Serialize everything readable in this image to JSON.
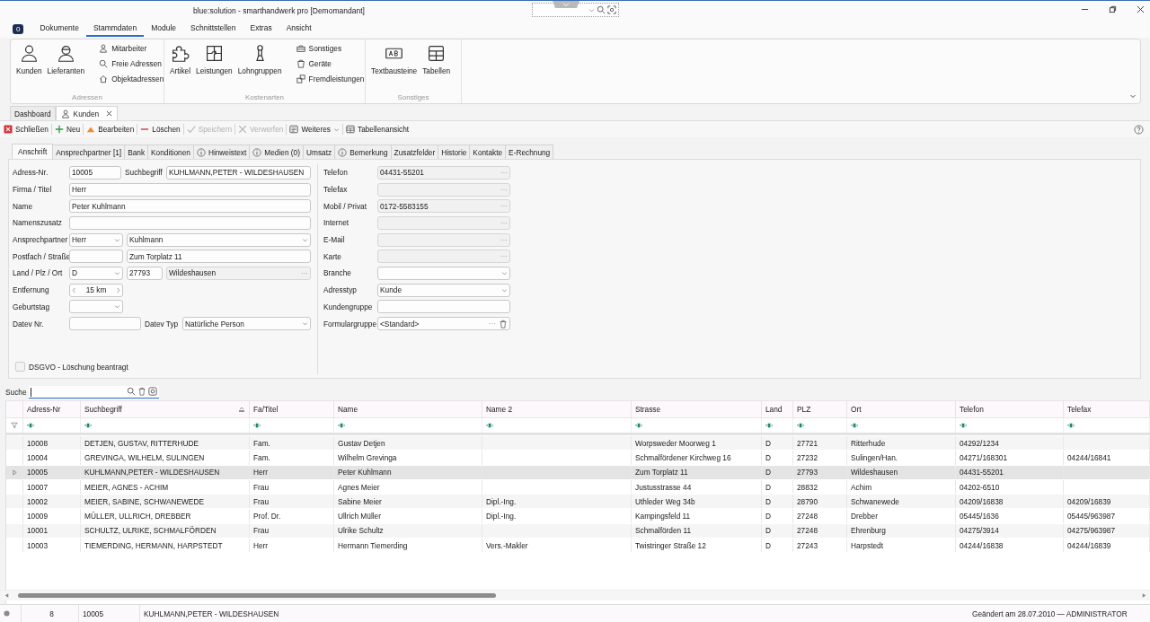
{
  "window": {
    "title": "blue:solution - smarthandwerk pro [Demomandant]"
  },
  "menu": {
    "badge": "0",
    "tabs": [
      {
        "label": "Dokumente",
        "selected": false
      },
      {
        "label": "Stammdaten",
        "selected": true
      },
      {
        "label": "Module",
        "selected": false
      },
      {
        "label": "Schnittstellen",
        "selected": false
      },
      {
        "label": "Extras",
        "selected": false
      },
      {
        "label": "Ansicht",
        "selected": false
      }
    ]
  },
  "ribbon": {
    "groups": [
      {
        "label": "Adressen",
        "large": [
          "Kunden",
          "Lieferanten"
        ],
        "small": [
          "Mitarbeiter",
          "Freie Adressen",
          "Objektadressen"
        ]
      },
      {
        "label": "Kostenarten",
        "large": [
          "Artikel",
          "Leistungen",
          "Lohngruppen"
        ],
        "small": [
          "Sonstiges",
          "Geräte",
          "Fremdleistungen"
        ]
      },
      {
        "label": "Sonstiges",
        "large": [
          "Textbausteine",
          "Tabellen"
        ]
      }
    ]
  },
  "document_tabs": [
    {
      "label": "Dashboard",
      "selected": false,
      "closable": false
    },
    {
      "label": "Kunden",
      "selected": true,
      "closable": true
    }
  ],
  "toolbar": [
    {
      "kind": "close",
      "label": "Schließen",
      "disabled": false
    },
    {
      "kind": "add",
      "label": "Neu",
      "disabled": false
    },
    {
      "kind": "edit",
      "label": "Bearbeiten",
      "disabled": false
    },
    {
      "kind": "delete",
      "label": "Löschen",
      "disabled": false
    },
    {
      "kind": "save",
      "label": "Speichern",
      "disabled": true
    },
    {
      "kind": "discard",
      "label": "Verwerfen",
      "disabled": true
    },
    {
      "kind": "menu",
      "label": "Weiteres",
      "disabled": false
    },
    {
      "kind": "table",
      "label": "Tabellenansicht",
      "disabled": false
    }
  ],
  "form_tabs": [
    {
      "label": "Anschrift",
      "selected": true,
      "info": false
    },
    {
      "label": "Ansprechpartner [1]",
      "selected": false,
      "info": false
    },
    {
      "label": "Bank",
      "selected": false,
      "info": false
    },
    {
      "label": "Konditionen",
      "selected": false,
      "info": false
    },
    {
      "label": "Hinweistext",
      "selected": false,
      "info": true
    },
    {
      "label": "Medien (0)",
      "selected": false,
      "info": true
    },
    {
      "label": "Umsatz",
      "selected": false,
      "info": false
    },
    {
      "label": "Bemerkung",
      "selected": false,
      "info": true
    },
    {
      "label": "Zusatzfelder",
      "selected": false,
      "info": false
    },
    {
      "label": "Historie",
      "selected": false,
      "info": false
    },
    {
      "label": "Kontakte",
      "selected": false,
      "info": false
    },
    {
      "label": "E-Rechnung",
      "selected": false,
      "info": false
    }
  ],
  "form_left": [
    {
      "label": "Adress-Nr.",
      "fields": [
        {
          "kind": "text",
          "value": "10005"
        },
        {
          "kind": "label",
          "value": "Suchbegriff"
        },
        {
          "kind": "text",
          "value": "KUHLMANN,PETER - WILDESHAUSEN"
        }
      ]
    },
    {
      "label": "Firma / Titel",
      "fields": [
        {
          "kind": "text",
          "value": "Herr"
        }
      ]
    },
    {
      "label": "Name",
      "fields": [
        {
          "kind": "text",
          "value": "Peter Kuhlmann"
        }
      ]
    },
    {
      "label": "Namenszusatz",
      "fields": [
        {
          "kind": "text"
        }
      ]
    },
    {
      "label": "Ansprechpartner",
      "fields": [
        {
          "kind": "select",
          "value": "Herr"
        },
        {
          "kind": "select",
          "value": "Kuhlmann"
        }
      ]
    },
    {
      "label": "Postfach / Straße",
      "fields": [
        {
          "kind": "text"
        },
        {
          "kind": "text",
          "value": "Zum Torplatz 11"
        }
      ]
    },
    {
      "label": "Land / Plz / Ort",
      "fields": [
        {
          "kind": "select",
          "value": "D"
        },
        {
          "kind": "text",
          "value": "27793"
        },
        {
          "kind": "lookup",
          "value": "Wildeshausen"
        }
      ]
    },
    {
      "label": "Entfernung",
      "fields": [
        {
          "kind": "spin",
          "value": "15 km"
        }
      ]
    },
    {
      "label": "Geburtstag",
      "fields": [
        {
          "kind": "select"
        }
      ]
    },
    {
      "label": "Datev Nr.",
      "fields": [
        {
          "kind": "text"
        },
        {
          "kind": "label",
          "value": "Datev Typ"
        },
        {
          "kind": "select",
          "value": "Natürliche Person"
        }
      ]
    }
  ],
  "gdpr_checkbox": {
    "label": "DSGVO - Löschung beantragt",
    "checked": false
  },
  "form_right": [
    {
      "label": "Telefon",
      "field": {
        "kind": "lookup",
        "value": "04431-55201"
      }
    },
    {
      "label": "Telefax",
      "field": {
        "kind": "lookup"
      }
    },
    {
      "label": "Mobil / Privat",
      "field": {
        "kind": "lookup",
        "value": "0172-5583155"
      }
    },
    {
      "label": "Internet",
      "field": {
        "kind": "lookup"
      }
    },
    {
      "label": "E-Mail",
      "field": {
        "kind": "lookup"
      }
    },
    {
      "label": "Karte",
      "field": {
        "kind": "lookup"
      }
    },
    {
      "label": "Branche",
      "field": {
        "kind": "select"
      }
    },
    {
      "label": "Adresstyp",
      "field": {
        "kind": "select",
        "value": "Kunde"
      }
    },
    {
      "label": "Kundengruppe",
      "field": {
        "kind": "text"
      }
    },
    {
      "label": "Formulargruppe",
      "field": {
        "kind": "lookup-delete",
        "value": "<Standard>"
      }
    }
  ],
  "search": {
    "label": "Suche",
    "focused": true
  },
  "table": {
    "columns": [
      {
        "label": "Adress-Nr",
        "sorted": false
      },
      {
        "label": "Suchbegriff",
        "sorted": true
      },
      {
        "label": "Fa/Titel",
        "sorted": false
      },
      {
        "label": "Name",
        "sorted": false
      },
      {
        "label": "Name 2",
        "sorted": false
      },
      {
        "label": "Strasse",
        "sorted": false
      },
      {
        "label": "Land",
        "sorted": false
      },
      {
        "label": "PLZ",
        "sorted": false
      },
      {
        "label": "Ort",
        "sorted": false
      },
      {
        "label": "Telefon",
        "sorted": false
      },
      {
        "label": "Telefax",
        "sorted": false
      }
    ],
    "rows": [
      {
        "selected": false,
        "cells": [
          "10008",
          "DETJEN, GUSTAV, RITTERHUDE",
          "Fam.",
          "Gustav Detjen",
          null,
          "Worpsweder Moorweg 1",
          "D",
          "27721",
          "Ritterhude",
          "04292/1234",
          null
        ]
      },
      {
        "selected": false,
        "cells": [
          "10004",
          "GREVINGA, WILHELM, SULINGEN",
          "Fam.",
          "Wilhelm Grevinga",
          null,
          "Schmalfördener Kirchweg 16",
          "D",
          "27232",
          "Sulingen/Han.",
          "04271/168301",
          "04244/16841"
        ]
      },
      {
        "selected": true,
        "cells": [
          "10005",
          "KUHLMANN,PETER - WILDESHAUSEN",
          "Herr",
          "Peter Kuhlmann",
          null,
          "Zum Torplatz 11",
          "D",
          "27793",
          "Wildeshausen",
          "04431-55201",
          null
        ]
      },
      {
        "selected": false,
        "cells": [
          "10007",
          "MEIER, AGNES - ACHIM",
          "Frau",
          "Agnes Meier",
          null,
          "Justusstrasse 44",
          "D",
          "28832",
          "Achim",
          "04202-6510",
          null
        ]
      },
      {
        "selected": false,
        "cells": [
          "10002",
          "MEIER, SABINE, SCHWANEWEDE",
          "Frau",
          "Sabine Meier",
          "Dipl.-Ing.",
          "Uthleder Weg 34b",
          "D",
          "28790",
          "Schwanewede",
          "04209/16838",
          "04209/16839"
        ]
      },
      {
        "selected": false,
        "cells": [
          "10009",
          "MÜLLER, ULLRICH, DREBBER",
          "Prof. Dr.",
          "Ullrich Müller",
          "Dipl.-Ing.",
          "Kampingsfeld 11",
          "D",
          "27248",
          "Drebber",
          "05445/1636",
          "05445/963987"
        ]
      },
      {
        "selected": false,
        "cells": [
          "10001",
          "SCHULTZ, ULRIKE, SCHMALFÖRDEN",
          "Frau",
          "Ulrike Schultz",
          null,
          "Schmalförden 11",
          "D",
          "27248",
          "Ehrenburg",
          "04275/3914",
          "04275/963987"
        ]
      },
      {
        "selected": false,
        "cells": [
          "10003",
          "TIEMERDING, HERMANN, HARPSTEDT",
          "Herr",
          "Hermann Tiemerding",
          "Vers.-Makler",
          "Twistringer Straße 12",
          "D",
          "27243",
          "Harpstedt",
          "04244/16838",
          "04244/16839"
        ]
      }
    ]
  },
  "status_bar": {
    "count": "8",
    "id": "10005",
    "search_term": "KUHLMANN,PETER - WILDESHAUSEN",
    "changed": "Geändert am 28.07.2010 — ADMINISTRATOR"
  }
}
